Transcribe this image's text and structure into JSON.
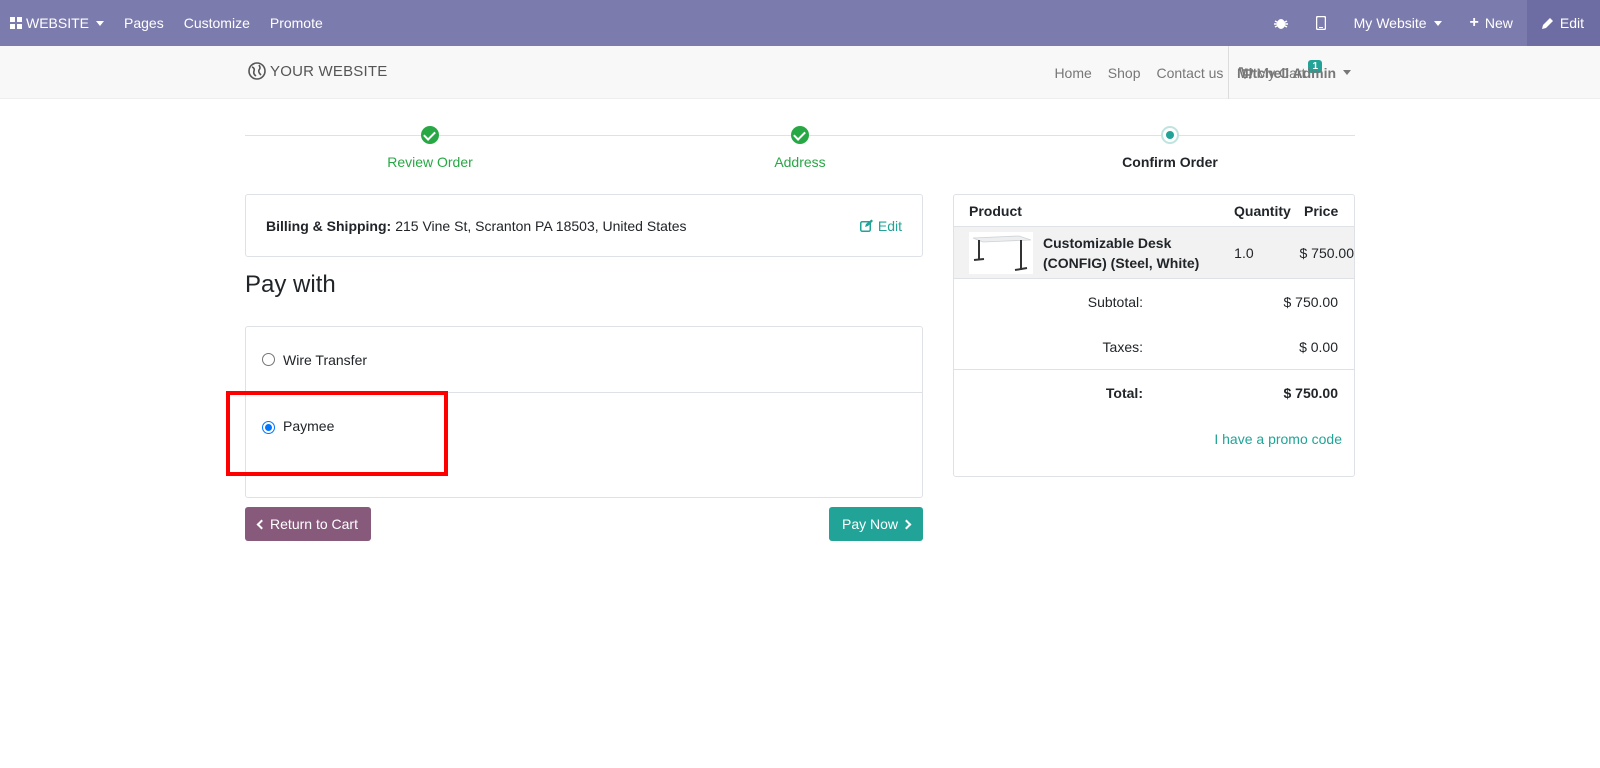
{
  "adminbar": {
    "website_label": "WEBSITE",
    "pages_label": "Pages",
    "customize_label": "Customize",
    "promote_label": "Promote",
    "website_switcher_label": "My Website",
    "new_label": "New",
    "edit_label": "Edit"
  },
  "header": {
    "logo_text": "YOUR WEBSITE",
    "nav": [
      "Home",
      "Shop",
      "Contact us"
    ],
    "cart_label": "My Cart",
    "cart_count": "1",
    "user_name": "Mitchell Admin"
  },
  "wizard": {
    "steps": [
      {
        "label": "Review Order",
        "state": "done"
      },
      {
        "label": "Address",
        "state": "done"
      },
      {
        "label": "Confirm Order",
        "state": "current"
      }
    ]
  },
  "billing": {
    "label": "Billing & Shipping:",
    "address": "215 Vine St, Scranton PA 18503, United States",
    "edit_label": "Edit"
  },
  "payment": {
    "title": "Pay with",
    "methods": [
      {
        "name": "Wire Transfer",
        "selected": false
      },
      {
        "name": "Paymee",
        "selected": true
      }
    ],
    "return_label": "Return to Cart",
    "pay_label": "Pay Now"
  },
  "summary": {
    "headers": {
      "product": "Product",
      "quantity": "Quantity",
      "price": "Price"
    },
    "line": {
      "name": "Customizable Desk (CONFIG) (Steel, White)",
      "quantity": "1.0",
      "price": "$ 750.00"
    },
    "subtotal_label": "Subtotal:",
    "subtotal_value": "$ 750.00",
    "taxes_label": "Taxes:",
    "taxes_value": "$ 0.00",
    "total_label": "Total:",
    "total_value": "$ 750.00",
    "promo_label": "I have a promo code"
  },
  "colors": {
    "adminbar": "#7c7bad",
    "accent": "#21a497",
    "done": "#28a745",
    "return_button": "#875a7b",
    "highlight": "#ff0000"
  }
}
